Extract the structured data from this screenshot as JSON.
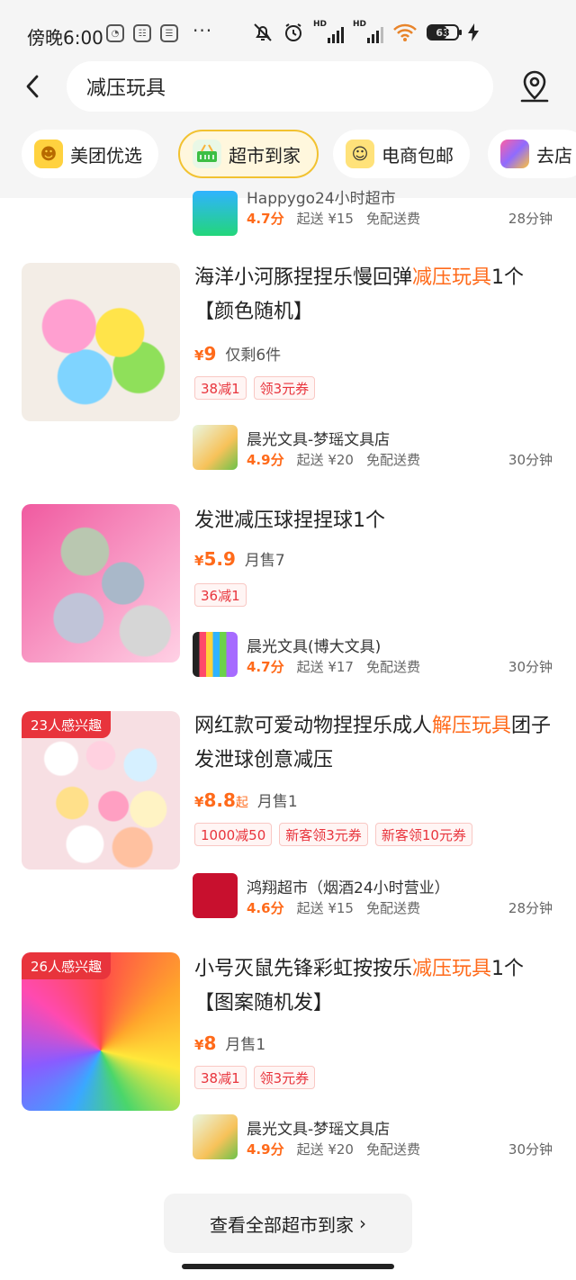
{
  "status_bar": {
    "time": "傍晚6:00",
    "more": "···",
    "battery": "63",
    "network_1": "HD",
    "network_2": "HD"
  },
  "search": {
    "query": "减压玩具"
  },
  "chips": [
    {
      "label": "美团优选"
    },
    {
      "label": "超市到家",
      "active": true
    },
    {
      "label": "电商包邮"
    },
    {
      "label": "去店"
    }
  ],
  "top_store": {
    "name": "Happygo24小时超市",
    "score": "4.7分",
    "min_order": "起送 ¥15",
    "delivery": "免配送费",
    "eta": "28分钟"
  },
  "items": [
    {
      "title_parts": [
        "海洋小河豚捏捏乐慢回弹",
        "减压玩具",
        "1个【颜色随机】"
      ],
      "price_symbol": "¥",
      "price": "9",
      "price_suffix": "",
      "sales": "仅剩6件",
      "tags": [
        "38减1",
        "领3元券"
      ],
      "badge": "",
      "store": {
        "name": "晨光文具-梦瑶文具店",
        "score": "4.9分",
        "min_order": "起送 ¥20",
        "delivery": "免配送费",
        "eta": "30分钟"
      }
    },
    {
      "title_parts": [
        "发泄减压球捏捏球1个",
        "",
        ""
      ],
      "price_symbol": "¥",
      "price": "5.9",
      "price_suffix": "",
      "sales": "月售7",
      "tags": [
        "36减1"
      ],
      "badge": "",
      "store": {
        "name": "晨光文具(博大文具)",
        "score": "4.7分",
        "min_order": "起送 ¥17",
        "delivery": "免配送费",
        "eta": "30分钟"
      }
    },
    {
      "title_parts": [
        "网红款可爱动物捏捏乐成人",
        "解压玩具",
        "团子发泄球创意减压"
      ],
      "price_symbol": "¥",
      "price": "8.8",
      "price_suffix": "起",
      "sales": "月售1",
      "tags": [
        "1000减50",
        "新客领3元券",
        "新客领10元券"
      ],
      "badge": "23人感兴趣",
      "store": {
        "name": "鸿翔超市（烟酒24小时营业）",
        "score": "4.6分",
        "min_order": "起送 ¥15",
        "delivery": "免配送费",
        "eta": "28分钟"
      }
    },
    {
      "title_parts": [
        "小号灭鼠先锋彩虹按按乐",
        "减压玩具",
        "1个【图案随机发】"
      ],
      "price_symbol": "¥",
      "price": "8",
      "price_suffix": "",
      "sales": "月售1",
      "tags": [
        "38减1",
        "领3元券"
      ],
      "badge": "26人感兴趣",
      "store": {
        "name": "晨光文具-梦瑶文具店",
        "score": "4.9分",
        "min_order": "起送 ¥20",
        "delivery": "免配送费",
        "eta": "30分钟"
      }
    }
  ],
  "view_all": {
    "label": "查看全部超市到家",
    "chevron": "›"
  },
  "colors": {
    "accent": "#ff6a1a",
    "tag_red": "#e8343c",
    "chip_active_border": "#f2c230",
    "header_bg": "#f5f5f5"
  },
  "icons": [
    "back-icon",
    "location-pin-icon",
    "bell-muted-icon",
    "alarm-icon",
    "wifi-icon",
    "battery-icon",
    "charging-icon"
  ]
}
